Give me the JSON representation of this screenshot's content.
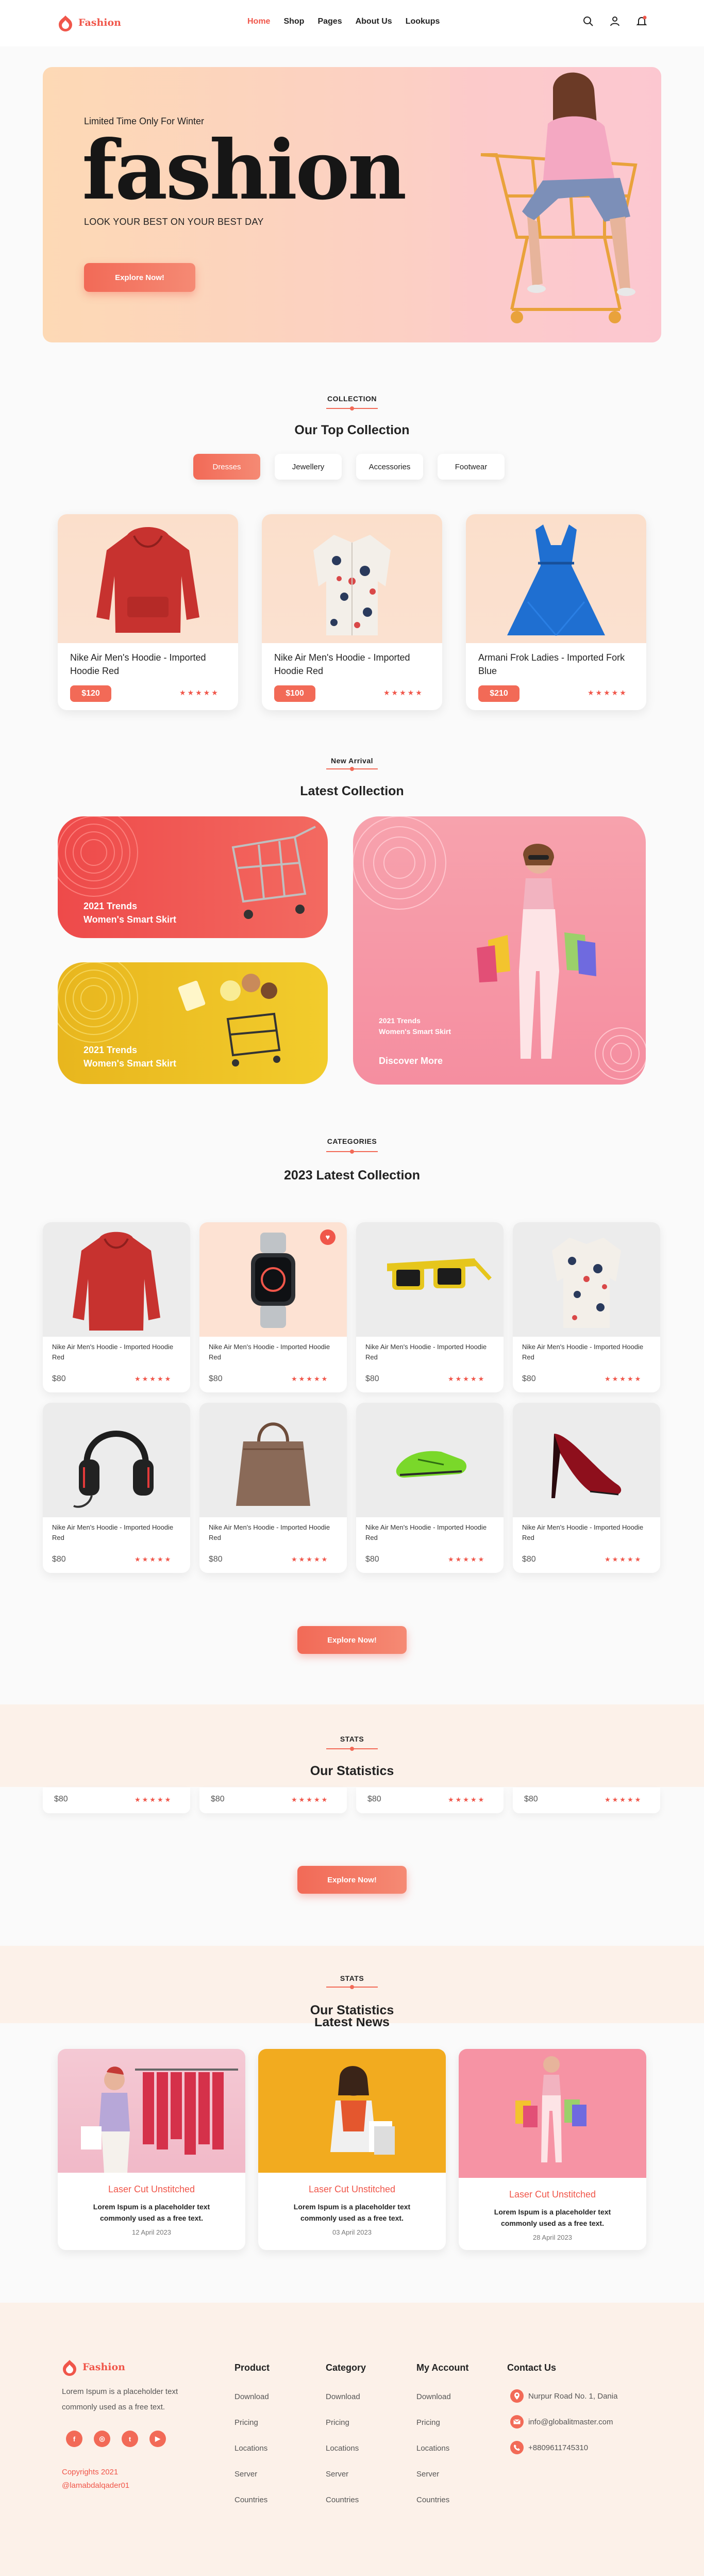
{
  "brand": {
    "name": "Fashion",
    "accent": "#f0564a"
  },
  "nav": {
    "links": [
      "Home",
      "Shop",
      "Pages",
      "About Us",
      "Lookups"
    ],
    "active": "Home",
    "icons": [
      "search-icon",
      "user-icon",
      "bell-icon"
    ]
  },
  "hero": {
    "kicker": "Limited Time Only For Winter",
    "title": "fashion",
    "subtitle": "LOOK YOUR BEST ON YOUR BEST DAY",
    "cta": "Explore Now!"
  },
  "collection": {
    "kicker": "COLLECTION",
    "title": "Our Top Collection",
    "tabs": [
      "Dresses",
      "Jewellery",
      "Accessories",
      "Footwear"
    ],
    "active_tab": "Dresses",
    "products": [
      {
        "name": "Nike Air Men's Hoodie - Imported Hoodie Red",
        "price": "$120",
        "rating": "★★★★★"
      },
      {
        "name": "Nike Air Men's Hoodie - Imported Hoodie Red",
        "price": "$100",
        "rating": "★★★★★"
      },
      {
        "name": "Armani Frok Ladies - Imported Fork Blue",
        "price": "$210",
        "rating": "★★★★★"
      }
    ]
  },
  "arrival": {
    "kicker": "New Arrival",
    "title": "Latest Collection",
    "banners": [
      {
        "line1": "2021 Trends",
        "line2": "Women's Smart Skirt"
      },
      {
        "line1": "2021 Trends",
        "line2": "Women's Smart Skirt"
      },
      {
        "line1": "2021 Trends",
        "line2": "Women's Smart Skirt",
        "cta": "Discover More"
      }
    ]
  },
  "categories": {
    "kicker": "CATEGORIES",
    "title": "2023 Latest Collection",
    "items": [
      {
        "name": "Nike Air Men's Hoodie - Imported Hoodie Red",
        "price": "$80",
        "rating": "★★★★★",
        "icon": "hoodie-icon"
      },
      {
        "name": "Nike Air Men's Hoodie - Imported Hoodie Red",
        "price": "$80",
        "rating": "★★★★★",
        "icon": "smartwatch-icon"
      },
      {
        "name": "Nike Air Men's Hoodie - Imported Hoodie Red",
        "price": "$80",
        "rating": "★★★★★",
        "icon": "sunglasses-icon"
      },
      {
        "name": "Nike Air Men's Hoodie - Imported Hoodie Red",
        "price": "$80",
        "rating": "★★★★★",
        "icon": "shirt-icon"
      },
      {
        "name": "Nike Air Men's Hoodie - Imported Hoodie Red",
        "price": "$80",
        "rating": "★★★★★",
        "icon": "headphones-icon"
      },
      {
        "name": "Nike Air Men's Hoodie - Imported Hoodie Red",
        "price": "$80",
        "rating": "★★★★★",
        "icon": "handbag-icon"
      },
      {
        "name": "Nike Air Men's Hoodie - Imported Hoodie Red",
        "price": "$80",
        "rating": "★★★★★",
        "icon": "sneaker-icon"
      },
      {
        "name": "Nike Air Men's Hoodie - Imported Hoodie Red",
        "price": "$80",
        "rating": "★★★★★",
        "icon": "heel-icon"
      }
    ],
    "cta": "Explore Now!"
  },
  "stats": {
    "kicker": "STATS",
    "title": "Our Statistics",
    "cards": [
      {
        "price": "$80",
        "rating": "★★★★★"
      },
      {
        "price": "$80",
        "rating": "★★★★★"
      },
      {
        "price": "$80",
        "rating": "★★★★★"
      },
      {
        "price": "$80",
        "rating": "★★★★★"
      }
    ],
    "cta": "Explore Now!"
  },
  "stats2": {
    "kicker": "STATS",
    "title": "Our Statistics"
  },
  "news": {
    "title": "Latest News",
    "items": [
      {
        "title": "Laser Cut Unstitched",
        "desc": "Lorem Ispum is a placeholder text commonly used as a free text.",
        "date": "12 April 2023"
      },
      {
        "title": "Laser Cut Unstitched",
        "desc": "Lorem Ispum is a placeholder text commonly used as a free text.",
        "date": "03 April 2023"
      },
      {
        "title": "Laser Cut Unstitched",
        "desc": "Lorem Ispum is a placeholder text commonly used as a free text.",
        "date": "28 April 2023"
      }
    ]
  },
  "footer": {
    "about": "Lorem Ispum is a placeholder text commonly used as a free text.",
    "social": [
      "f",
      "◎",
      "t",
      "▶"
    ],
    "copyright": "Copyrights 2021",
    "handle": "@lamabdalqader01",
    "columns": [
      {
        "title": "Product",
        "links": [
          "Download",
          "Pricing",
          "Locations",
          "Server",
          "Countries"
        ]
      },
      {
        "title": "Category",
        "links": [
          "Download",
          "Pricing",
          "Locations",
          "Server",
          "Countries"
        ]
      },
      {
        "title": "My Account",
        "links": [
          "Download",
          "Pricing",
          "Locations",
          "Server",
          "Countries"
        ]
      }
    ],
    "contact": {
      "title": "Contact Us",
      "items": [
        "Nurpur Road No. 1, Dania",
        "info@globalitmaster.com",
        "+8809611745310"
      ]
    }
  }
}
